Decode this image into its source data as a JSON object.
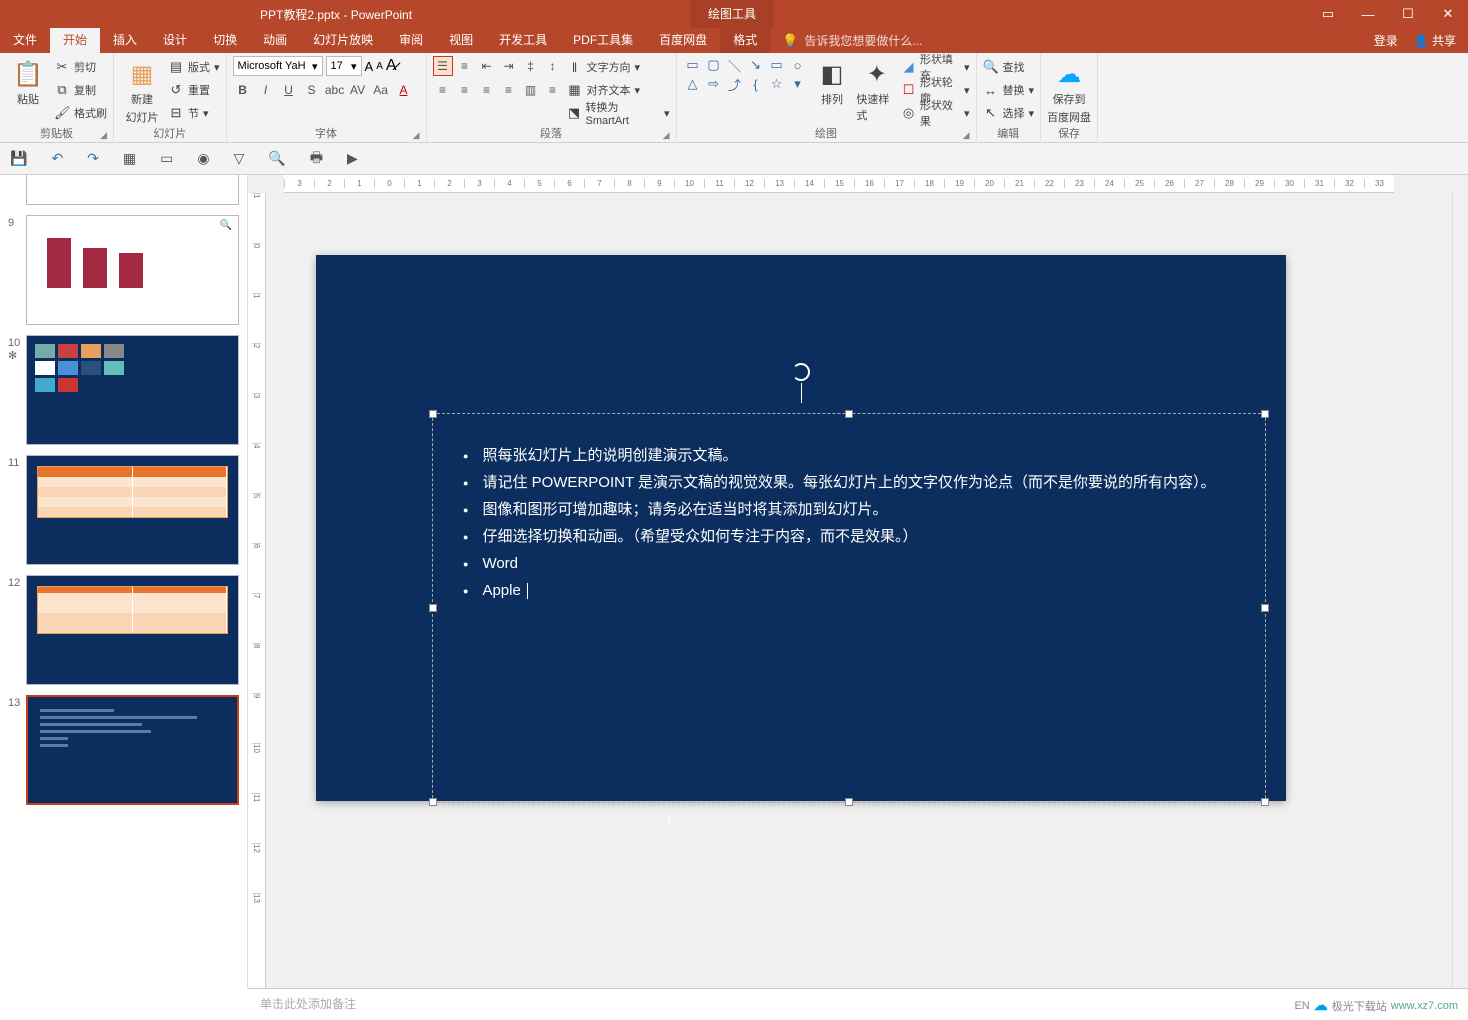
{
  "title": "PPT教程2.pptx - PowerPoint",
  "draw_tool_label": "绘图工具",
  "tabs": {
    "file": "文件",
    "home": "开始",
    "insert": "插入",
    "design": "设计",
    "transitions": "切换",
    "animations": "动画",
    "slideshow": "幻灯片放映",
    "review": "审阅",
    "view": "视图",
    "developer": "开发工具",
    "pdf": "PDF工具集",
    "baidu": "百度网盘",
    "format": "格式"
  },
  "tell_me": "告诉我您想要做什么...",
  "login": "登录",
  "share": "共享",
  "ribbon": {
    "clipboard": {
      "label": "剪贴板",
      "paste": "粘贴",
      "cut": "剪切",
      "copy": "复制",
      "format_painter": "格式刷"
    },
    "slides": {
      "label": "幻灯片",
      "new_slide_l1": "新建",
      "new_slide_l2": "幻灯片",
      "layout": "版式",
      "reset": "重置",
      "section": "节"
    },
    "font": {
      "label": "字体",
      "name": "Microsoft YaH",
      "size": "17"
    },
    "paragraph": {
      "label": "段落",
      "text_direction": "文字方向",
      "align_text": "对齐文本",
      "convert_smartart": "转换为 SmartArt"
    },
    "drawing": {
      "label": "绘图",
      "arrange": "排列",
      "quick_styles": "快速样式",
      "shape_fill": "形状填充",
      "shape_outline": "形状轮廓",
      "shape_effects": "形状效果"
    },
    "editing": {
      "label": "编辑",
      "find": "查找",
      "replace": "替换",
      "select": "选择"
    },
    "save": {
      "label": "保存",
      "save_to_l1": "保存到",
      "save_to_l2": "百度网盘"
    }
  },
  "thumbs": [
    {
      "num": "9"
    },
    {
      "num": "10"
    },
    {
      "num": "11"
    },
    {
      "num": "12"
    },
    {
      "num": "13"
    }
  ],
  "slide_content": {
    "bullets": [
      "照每张幻灯片上的说明创建演示文稿。",
      "请记住 POWERPOINT 是演示文稿的视觉效果。每张幻灯片上的文字仅作为论点（而不是你要说的所有内容）。",
      "图像和图形可增加趣味；请务必在适当时将其添加到幻灯片。",
      "仔细选择切换和动画。（希望受众如何专注于内容，而不是效果。）",
      "Word",
      "Apple"
    ]
  },
  "notes_placeholder": "单击此处添加备注",
  "status": {
    "lang": "EN"
  },
  "watermark": "极光下载站",
  "watermark_url": "www.xz7.com"
}
